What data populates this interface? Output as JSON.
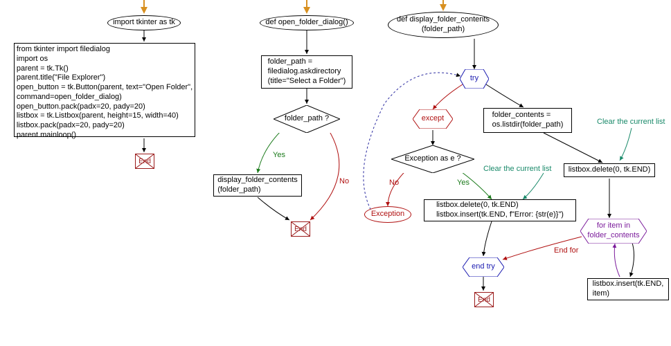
{
  "flowchart1": {
    "start": "import tkinter as tk",
    "block": "from tkinter import filedialog\nimport os\nparent = tk.Tk()\nparent.title(\"File Explorer\")\nopen_button = tk.Button(parent, text=\"Open Folder\",\ncommand=open_folder_dialog)\nopen_button.pack(padx=20, pady=20)\nlistbox = tk.Listbox(parent, height=15, width=40)\nlistbox.pack(padx=20, pady=20)\nparent.mainloop()",
    "end": "End"
  },
  "flowchart2": {
    "start": "def open_folder_dialog()",
    "block1": "folder_path =\nfiledialog.askdirectory\n(title=\"Select a Folder\")",
    "decision": "folder_path ?",
    "yes": "Yes",
    "no": "No",
    "block2": "display_folder_contents\n(folder_path)",
    "end": "End"
  },
  "flowchart3": {
    "start": "def display_folder_contents\n(folder_path)",
    "try": "try",
    "except": "except",
    "decision": "Exception as e ?",
    "yes": "Yes",
    "no": "No",
    "exception_label": "Exception",
    "err_block": "listbox.delete(0, tk.END)\nlistbox.insert(tk.END, f\"Error: {str(e)}\")",
    "end_try": "end try",
    "end": "End",
    "ok_block1": "folder_contents =\nos.listdir(folder_path)",
    "ok_block2": "listbox.delete(0, tk.END)",
    "for_loop": "for item in\nfolder_contents",
    "end_for": "End for",
    "loop_body": "listbox.insert(tk.END,\nitem)",
    "annotation1": "Clear the current list",
    "annotation2": "Clear the current list"
  }
}
